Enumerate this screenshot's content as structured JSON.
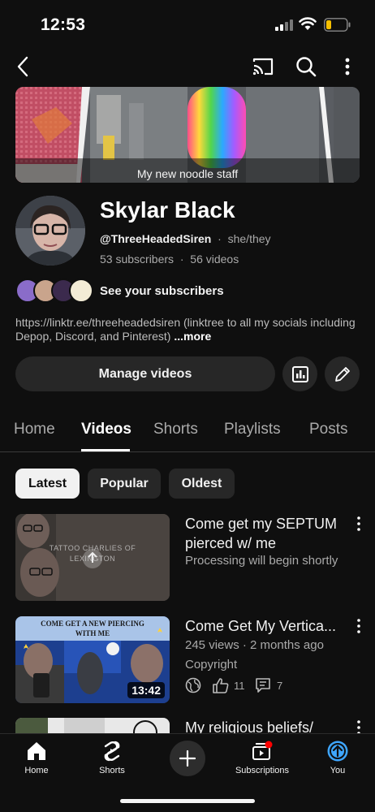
{
  "status_bar": {
    "time": "12:53"
  },
  "banner": {
    "caption": "My new noodle staff"
  },
  "channel": {
    "name": "Skylar Black",
    "handle": "@ThreeHeadedSiren",
    "pronouns": "she/they",
    "subscribers": "53 subscribers",
    "videos": "56 videos",
    "see_subscribers": "See your subscribers",
    "description": "https://linktr.ee/threeheadedsiren (linktree to all my socials including Depop, Discord, and Pinterest)",
    "more": "...more",
    "manage_videos": "Manage videos"
  },
  "tabs": [
    "Home",
    "Videos",
    "Shorts",
    "Playlists",
    "Posts"
  ],
  "chips": [
    "Latest",
    "Popular",
    "Oldest"
  ],
  "videos": [
    {
      "title": "Come get my SEPTUM pierced w/ me",
      "status": "Processing will begin shortly",
      "thumb_text": "TATTOO CHARLIES OF LEXINGTON"
    },
    {
      "title": "Come Get My Vertica...",
      "meta": "245 views · 2 months ago",
      "copyright": "Copyright",
      "likes": "11",
      "comments": "7",
      "duration": "13:42",
      "thumb_text": "COME GET A NEW PIERCING WITH ME"
    },
    {
      "title": "My religious beliefs/"
    }
  ],
  "bottom_nav": {
    "home": "Home",
    "shorts": "Shorts",
    "subscriptions": "Subscriptions",
    "you": "You"
  },
  "colors": {
    "background": "#0f0f0f",
    "surface": "#272727",
    "accent_you": "#3ea6ff",
    "notification_dot": "#ff0000"
  }
}
